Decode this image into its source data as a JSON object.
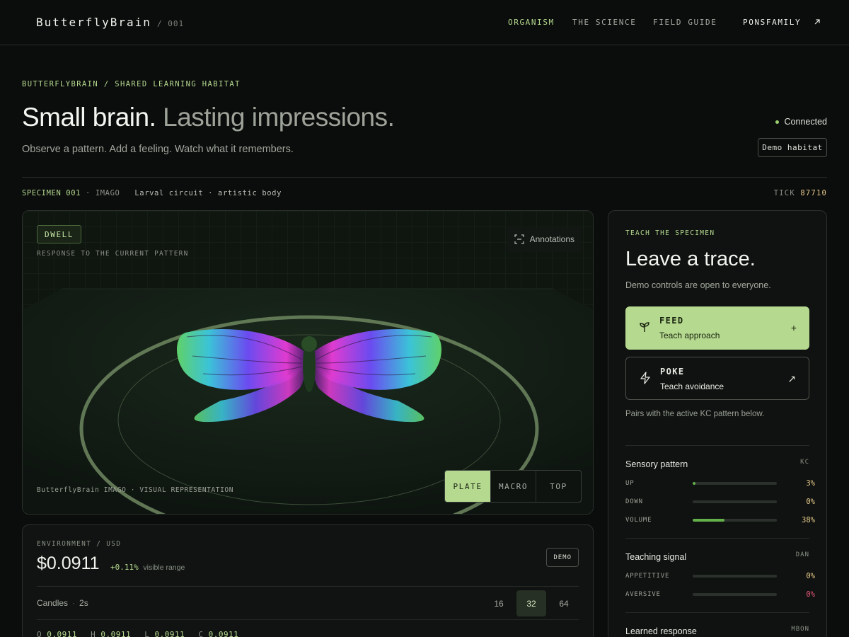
{
  "nav": {
    "brand": "ButterflyBrain",
    "brand_num": "/ 001",
    "links": [
      "ORGANISM",
      "THE SCIENCE",
      "FIELD GUIDE"
    ],
    "external": "PONSFAMILY",
    "external_icon": "arrow-up-right-icon"
  },
  "hero": {
    "breadcrumb": "BUTTERFLYBRAIN / SHARED LEARNING HABITAT",
    "headline_a": "Small brain.",
    "headline_b": "Lasting impressions.",
    "subtitle": "Observe a pattern. Add a feeling. Watch what it remembers.",
    "status": "Connected",
    "demo_button": "Demo habitat"
  },
  "specimen": {
    "id": "SPECIMEN 001",
    "stage": "IMAGO",
    "desc": "Larval circuit · artistic body",
    "tick_label": "TICK",
    "tick_value": "87710"
  },
  "stage": {
    "state_badge": "DWELL",
    "state_caption": "RESPONSE TO THE CURRENT PATTERN",
    "annotations": "Annotations",
    "visual_caption": "ButterflyBrain IMAGO · VISUAL REPRESENTATION",
    "views": [
      "PLATE",
      "MACRO",
      "TOP"
    ],
    "active_view": "PLATE"
  },
  "environment": {
    "label": "ENVIRONMENT / USD",
    "price": "$0.0911",
    "change": "+0.11%",
    "change_suffix": "visible range",
    "demo_tag": "DEMO",
    "candles_label": "Candles",
    "candles_interval": "2s",
    "candle_counts": [
      "16",
      "32",
      "64"
    ],
    "active_count": "32",
    "ohlc": [
      {
        "k": "O",
        "v": "0.0911"
      },
      {
        "k": "H",
        "v": "0.0911"
      },
      {
        "k": "L",
        "v": "0.0911"
      },
      {
        "k": "C",
        "v": "0.0911"
      }
    ]
  },
  "teach": {
    "label": "TEACH THE SPECIMEN",
    "title": "Leave a trace.",
    "subtitle": "Demo controls are open to everyone.",
    "feed": {
      "name": "FEED",
      "desc": "Teach approach",
      "trail": "+"
    },
    "poke": {
      "name": "POKE",
      "desc": "Teach avoidance",
      "trail": "↗"
    },
    "pairs_note": "Pairs with the active KC pattern below.",
    "sensory": {
      "title": "Sensory pattern",
      "tag": "KC",
      "rows": [
        {
          "label": "UP",
          "value": "3%",
          "level": 0.03
        },
        {
          "label": "DOWN",
          "value": "0%",
          "level": 0.0
        },
        {
          "label": "VOLUME",
          "value": "38%",
          "level": 0.38
        }
      ]
    },
    "signal": {
      "title": "Teaching signal",
      "tag": "DAN",
      "rows": [
        {
          "label": "APPETITIVE",
          "value": "0%",
          "level": 0.0
        },
        {
          "label": "AVERSIVE",
          "value": "0%",
          "level": 0.0
        }
      ]
    },
    "learned": {
      "title": "Learned response",
      "tag": "MBON"
    }
  },
  "colors": {
    "accent_green": "#b5d98f",
    "bar_green": "#63b04b",
    "value_amber": "#e7c98a",
    "aversive_pink": "#e05577"
  }
}
